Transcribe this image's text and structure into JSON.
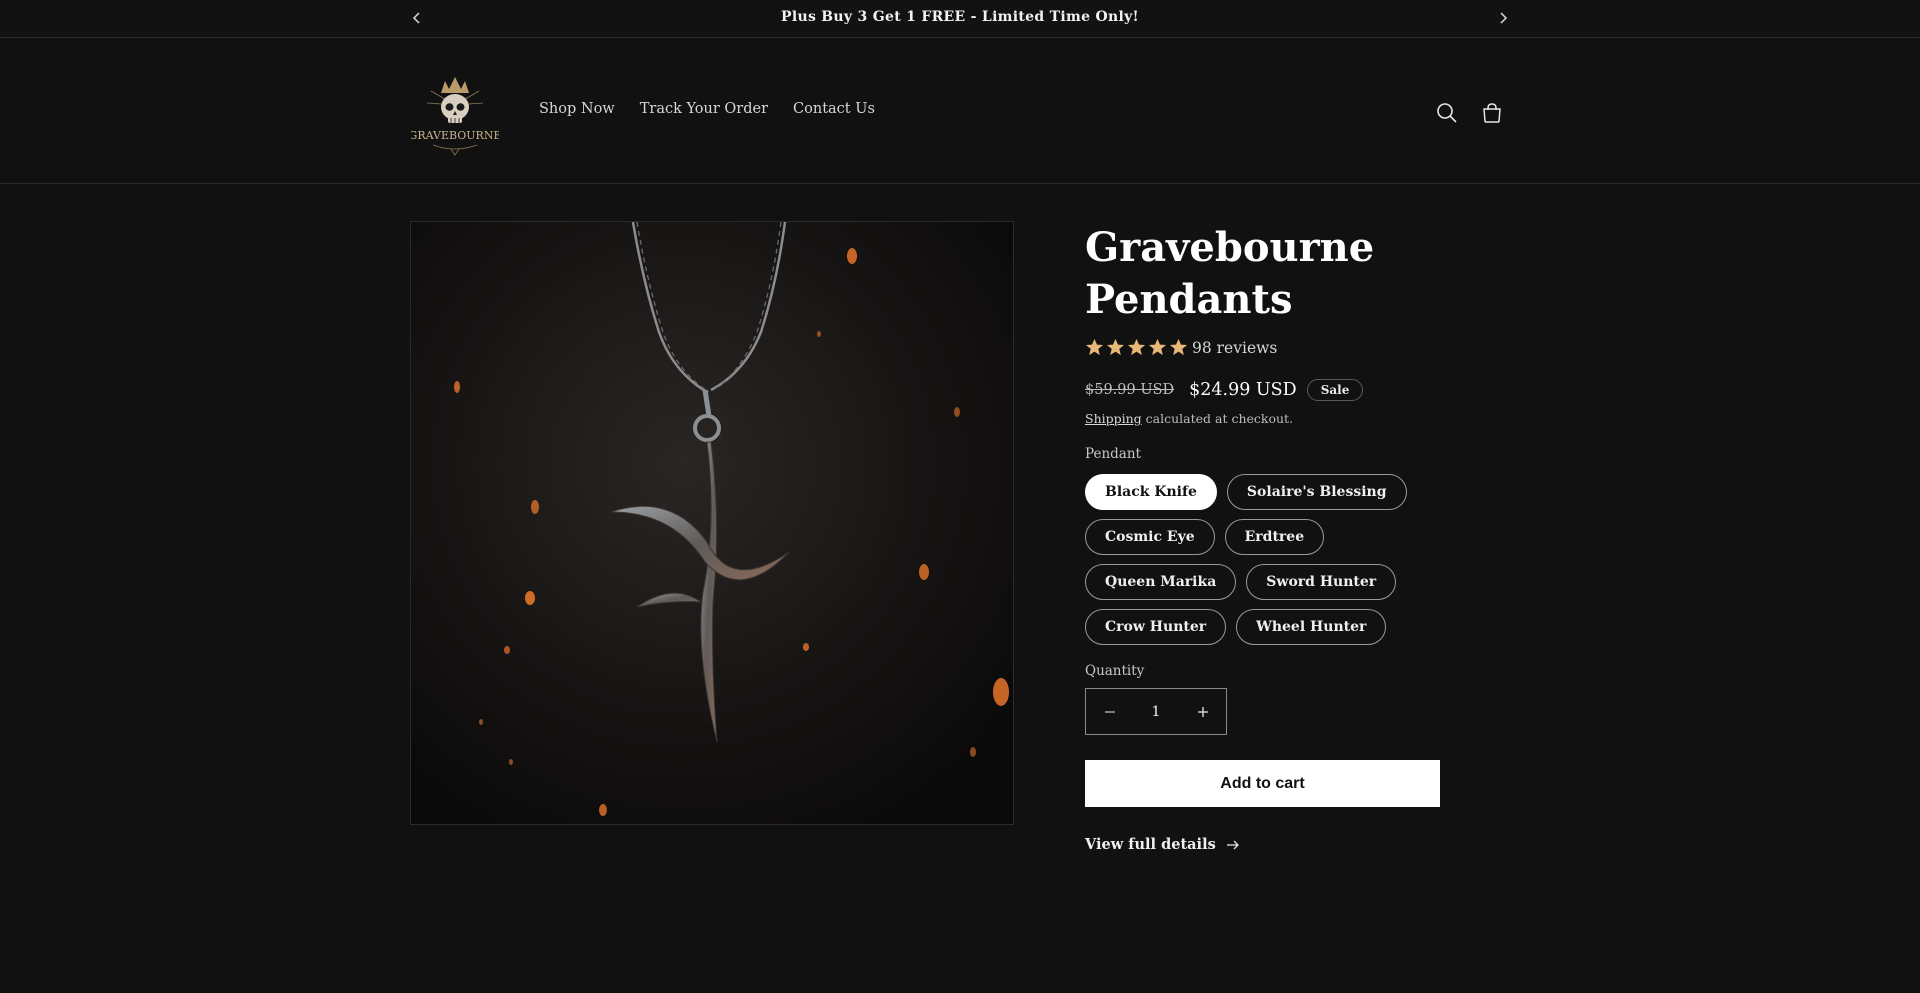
{
  "announcement": {
    "text": "Plus Buy 3 Get 1 FREE - Limited Time Only!"
  },
  "header": {
    "logo_text": "GRAVEBOURNE",
    "nav": [
      {
        "label": "Shop Now"
      },
      {
        "label": "Track Your Order"
      },
      {
        "label": "Contact Us"
      }
    ],
    "icons": [
      "search-icon",
      "cart-icon"
    ]
  },
  "product": {
    "title": "Gravebourne Pendants",
    "rating": {
      "stars": 5,
      "reviews_label": "98 reviews"
    },
    "price_old": "$59.99 USD",
    "price_new": "$24.99 USD",
    "sale_badge": "Sale",
    "shipping_link": "Shipping",
    "shipping_text": " calculated at checkout.",
    "option_label": "Pendant",
    "variants": [
      {
        "label": "Black Knife",
        "selected": true
      },
      {
        "label": "Solaire's Blessing",
        "selected": false
      },
      {
        "label": "Cosmic Eye",
        "selected": false
      },
      {
        "label": "Erdtree",
        "selected": false
      },
      {
        "label": "Queen Marika",
        "selected": false
      },
      {
        "label": "Sword Hunter",
        "selected": false
      },
      {
        "label": "Crow Hunter",
        "selected": false
      },
      {
        "label": "Wheel Hunter",
        "selected": false
      }
    ],
    "quantity_label": "Quantity",
    "quantity": "1",
    "add_to_cart": "Add to cart",
    "view_details": "View full details"
  },
  "colors": {
    "background": "#111111",
    "star": "#e8b878",
    "button_bg": "#ffffff"
  }
}
